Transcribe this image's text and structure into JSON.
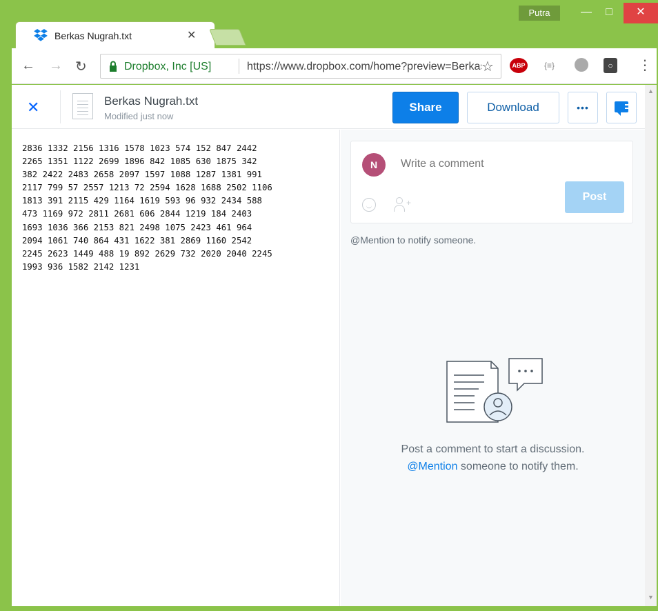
{
  "browser": {
    "profile_name": "Putra",
    "tab_title": "Berkas Nugrah.txt",
    "site_identity": "Dropbox, Inc [US]",
    "url": "https://www.dropbox.com/home?preview=Berkas+Nugrah.txt",
    "extensions": [
      "ABP",
      "{≡}"
    ]
  },
  "header": {
    "file_name": "Berkas Nugrah.txt",
    "modified": "Modified just now",
    "share_label": "Share",
    "download_label": "Download",
    "more_label": "•••"
  },
  "file_content": [
    "2836 1332 2156 1316 1578 1023 574 152 847 2442",
    "2265 1351 1122 2699 1896 842 1085 630 1875 342",
    "382 2422 2483 2658 2097 1597 1088 1287 1381 991",
    "2117 799 57 2557 1213 72 2594 1628 1688 2502 1106",
    "1813 391 2115 429 1164 1619 593 96 932 2434 588",
    "473 1169 972 2811 2681 606 2844 1219 184 2403",
    "1693 1036 366 2153 821 2498 1075 2423 461 964",
    "2094 1061 740 864 431 1622 381 2869 1160 2542",
    "2245 2623 1449 488 19 892 2629 732 2020 2040 2245",
    "1993 936 1582 2142 1231"
  ],
  "comments": {
    "avatar_initial": "N",
    "placeholder": "Write a comment",
    "post_label": "Post",
    "mention_hint": "@Mention to notify someone.",
    "empty_line1": "Post a comment to start a discussion.",
    "empty_mention": "@Mention",
    "empty_line2_rest": " someone to notify them."
  },
  "colors": {
    "chrome_frame": "#8bc34a",
    "dropbox_blue": "#0d7fe8",
    "avatar": "#b54f77"
  }
}
